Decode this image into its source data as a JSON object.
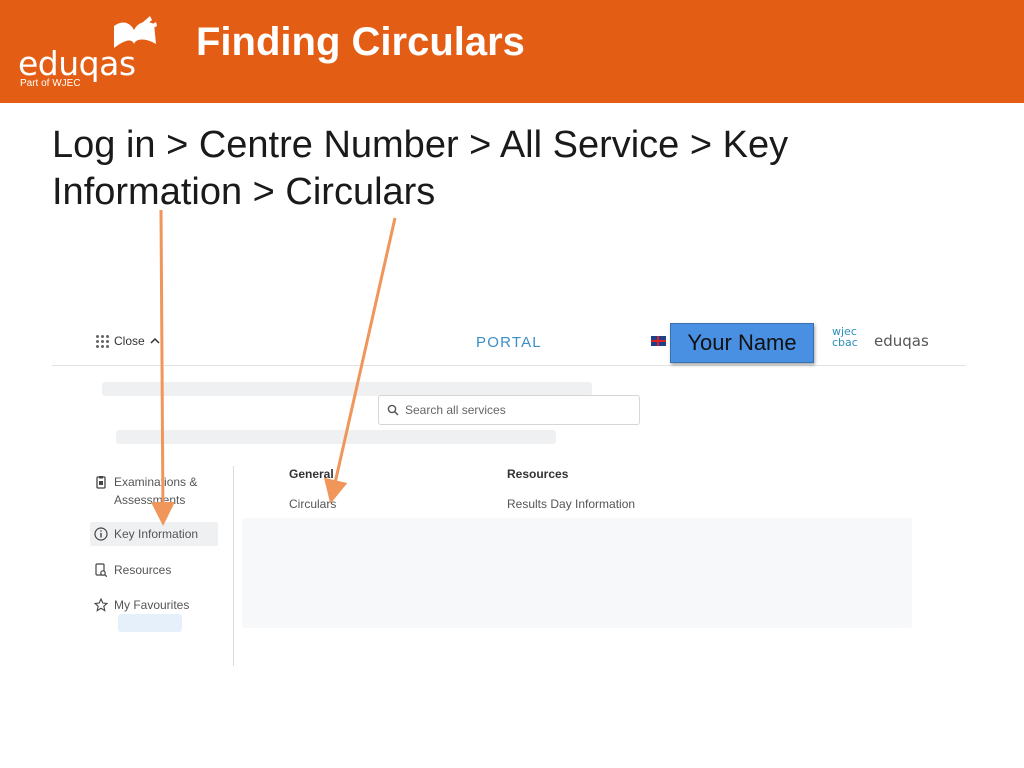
{
  "header": {
    "brand": "eduqas",
    "brand_sub": "Part of WJEC",
    "title": "Finding Circulars",
    "color": "#e35d14"
  },
  "instruction": "Log in > Centre Number > All Service > Key Information > Circulars",
  "portal": {
    "close_label": "Close",
    "portal_label": "PORTAL",
    "user_button": "Your Name",
    "wjec_logo_line1": "wjec",
    "wjec_logo_line2": "cbac",
    "eduqas_logo": "eduqas",
    "search_placeholder": "Search all services",
    "sidebar": {
      "items": [
        {
          "label": "Examinations & Assessments",
          "icon": "clipboard-icon"
        },
        {
          "label": "Key Information",
          "icon": "info-icon",
          "active": true
        },
        {
          "label": "Resources",
          "icon": "document-search-icon"
        },
        {
          "label": "My Favourites",
          "icon": "star-icon"
        }
      ]
    },
    "columns": [
      {
        "heading": "General",
        "links": [
          "Circulars"
        ]
      },
      {
        "heading": "Resources",
        "links": [
          "Results Day Information"
        ]
      }
    ],
    "accent": "#3a8fc8",
    "arrow_color": "#f0965a"
  }
}
